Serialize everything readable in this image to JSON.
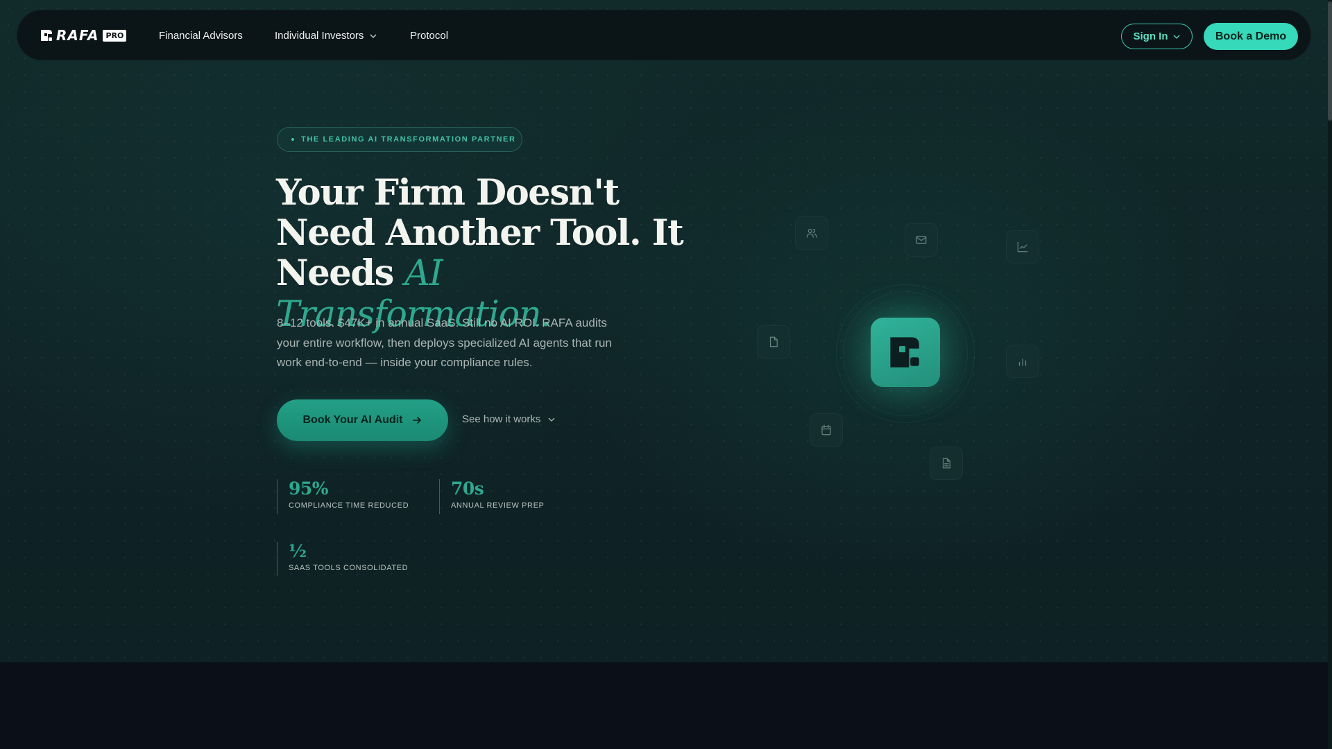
{
  "nav": {
    "logo_text": "RAFA",
    "logo_badge": "PRO",
    "links": [
      "Financial Advisors",
      "Individual Investors",
      "Protocol"
    ],
    "signin_label": "Sign In",
    "demo_label": "Book a Demo"
  },
  "hero": {
    "badge": "THE LEADING AI TRANSFORMATION PARTNER",
    "headline_plain": "Your Firm Doesn't Need Another Tool. It Needs ",
    "headline_accent": "AI Transformation.",
    "subtitle": "8–12 tools. $47K+ in annual SaaS. Still no AI ROI. RAFA audits your entire workflow, then deploys specialized AI agents that run work end-to-end — inside your compliance rules.",
    "cta_label": "Book Your AI Audit",
    "secondary_label": "See how it works",
    "stats": [
      {
        "value": "95%",
        "label": "COMPLIANCE TIME REDUCED"
      },
      {
        "value": "70s",
        "label": "ANNUAL REVIEW PREP"
      },
      {
        "value": "½",
        "label": "SAAS TOOLS CONSOLIDATED"
      }
    ]
  },
  "diagram": {
    "center_icon": "rafa-logo-icon",
    "satellite_icons": [
      "users-icon",
      "mail-icon",
      "line-chart-icon",
      "file-icon",
      "bar-chart-icon",
      "calendar-icon",
      "document-icon"
    ]
  },
  "colors": {
    "accent": "#36d9b9",
    "accent_dark": "#2ea88e",
    "background": "#0f2326",
    "footer": "#0b0f17"
  }
}
